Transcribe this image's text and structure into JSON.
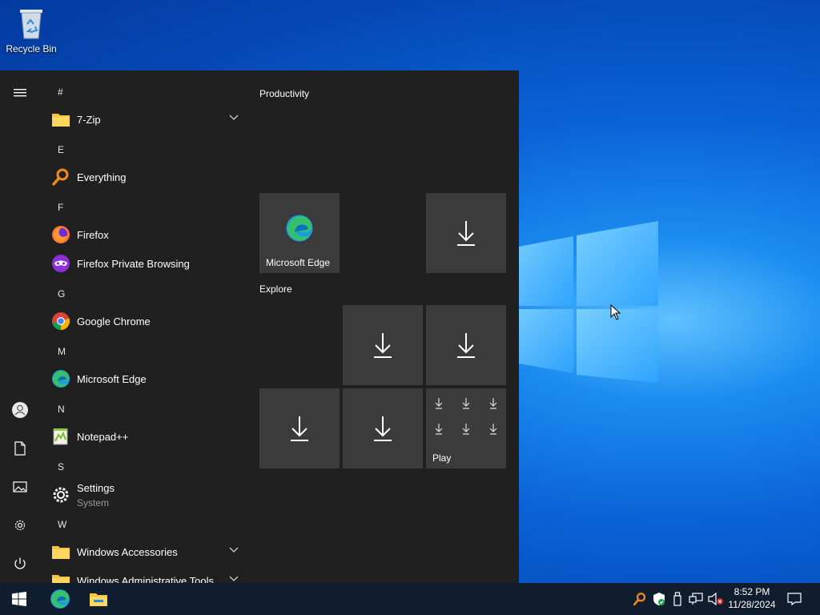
{
  "desktop": {
    "recycle_bin_label": "Recycle Bin"
  },
  "start_menu": {
    "letters": [
      "#",
      "E",
      "F",
      "G",
      "M",
      "N",
      "S",
      "W"
    ],
    "apps": {
      "seven_zip": "7-Zip",
      "everything": "Everything",
      "firefox": "Firefox",
      "firefox_private": "Firefox Private Browsing",
      "chrome": "Google Chrome",
      "edge": "Microsoft Edge",
      "notepadpp": "Notepad++",
      "settings": "Settings",
      "settings_sub": "System",
      "win_accessories": "Windows Accessories",
      "win_admin_tools": "Windows Administrative Tools"
    },
    "groups": {
      "productivity": "Productivity",
      "explore": "Explore"
    },
    "tiles": {
      "edge_label": "Microsoft Edge",
      "play_label": "Play"
    }
  },
  "taskbar": {
    "time": "8:52 PM",
    "date": "11/28/2024"
  },
  "colors": {
    "start_bg": "#202020",
    "tile_bg": "#3b3b3b",
    "taskbar_bg": "#101d2e",
    "accent_blue": "#0a62d6"
  }
}
